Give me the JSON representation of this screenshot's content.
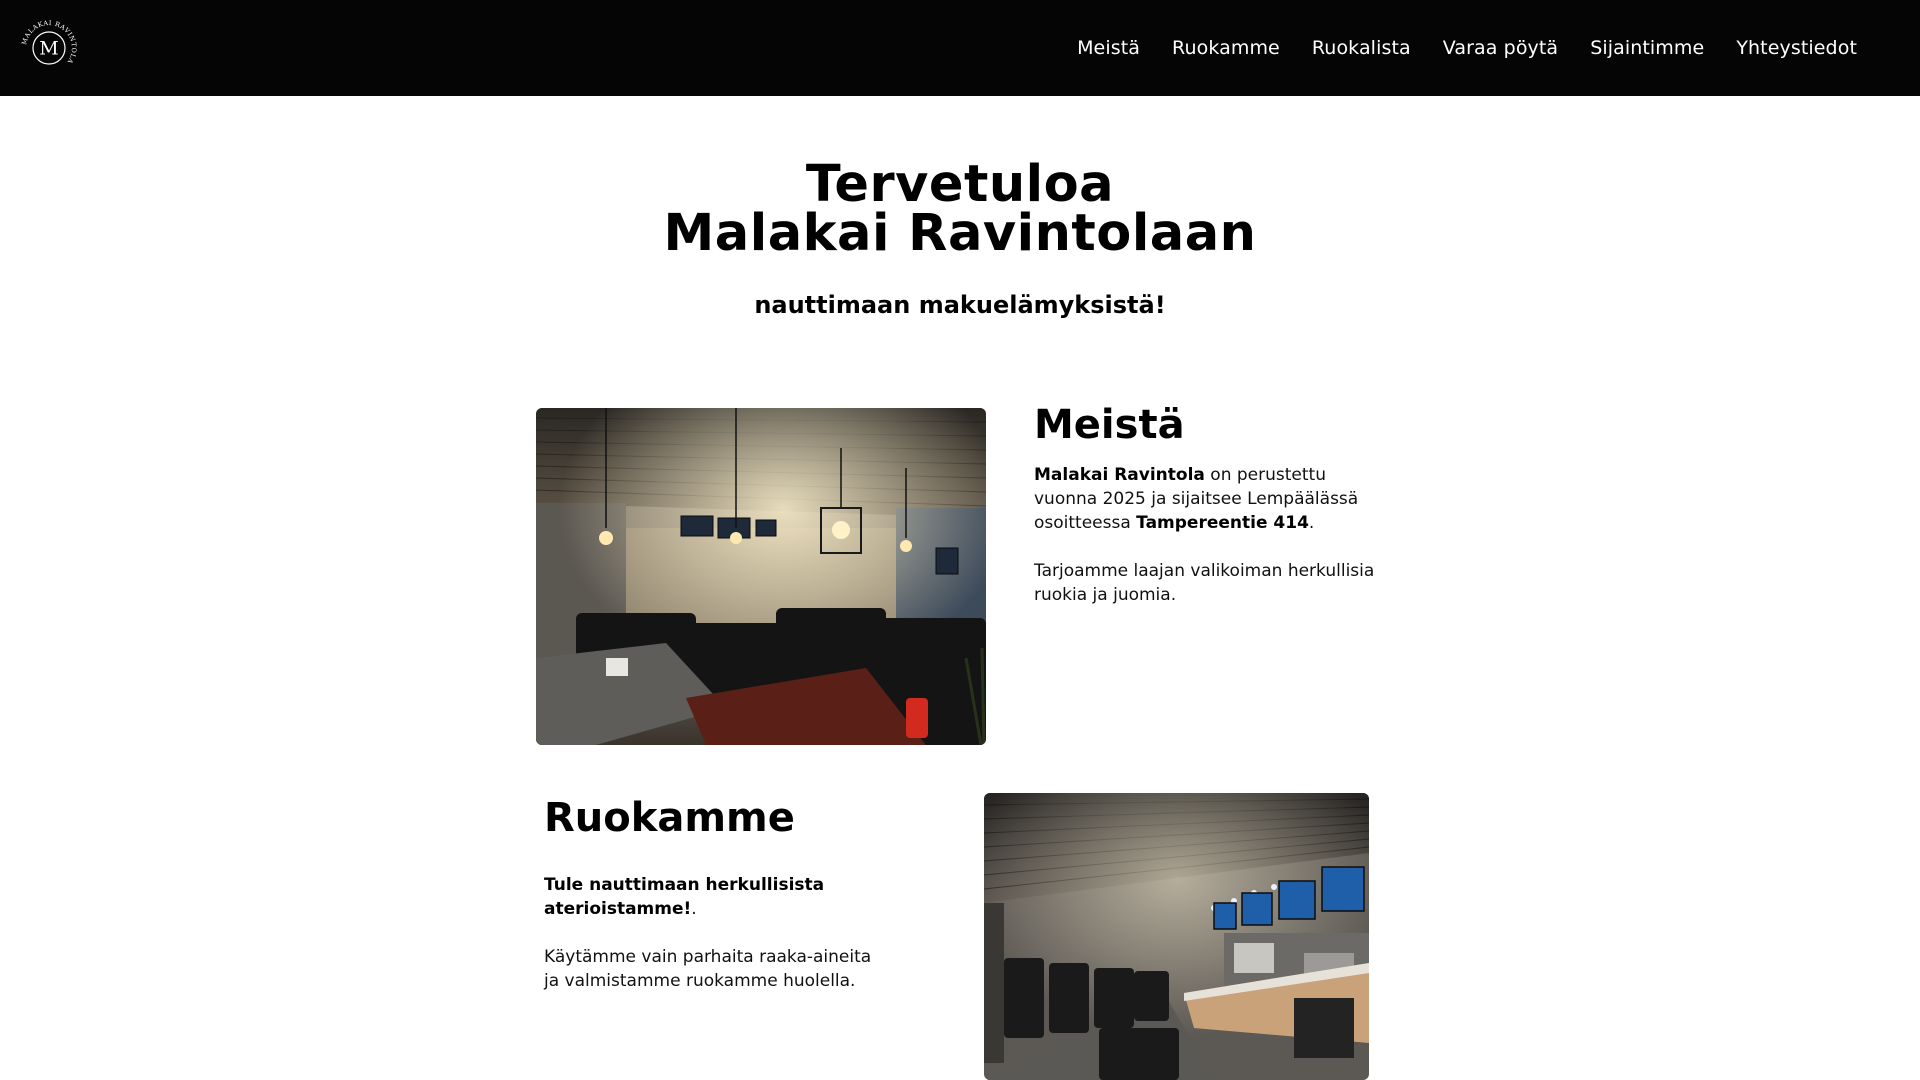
{
  "header": {
    "logo": {
      "icon": "malakai-ravintola-logo",
      "letter": "M",
      "ring_text": "MALAKAI RAVINTOLA"
    },
    "nav": [
      {
        "label": "Meistä"
      },
      {
        "label": "Ruokamme"
      },
      {
        "label": "Ruokalista"
      },
      {
        "label": "Varaa pöytä"
      },
      {
        "label": "Sijaintimme"
      },
      {
        "label": "Yhteystiedot"
      }
    ]
  },
  "hero": {
    "title_line1": "Tervetuloa",
    "title_line2": "Malakai Ravintolaan",
    "subtitle": "nauttimaan makuelämyksistä!"
  },
  "about": {
    "title": "Meistä",
    "p1_bold1": "Malakai Ravintola",
    "p1_text1": " on perustettu vuonna 2025 ja sijaitsee Lempäälässä osoitteessa ",
    "p1_bold2": "Tampereentie 414",
    "p1_text2": ".",
    "p2": "Tarjoamme laajan valikoiman herkullisia ruokia ja juomia.",
    "image": "restaurant-dining-room-photo"
  },
  "food": {
    "title": "Ruokamme",
    "p1_bold": "Tule nauttimaan herkullisista aterioistamme!",
    "p1_text": ".",
    "p2": "Käytämme vain parhaita raaka-aineita ja valmistamme ruokamme huolella.",
    "image": "restaurant-counter-kitchen-photo"
  },
  "colors": {
    "header_bg": "#050505",
    "header_text": "#ffffff",
    "page_bg": "#ffffff",
    "heading": "#000000"
  }
}
